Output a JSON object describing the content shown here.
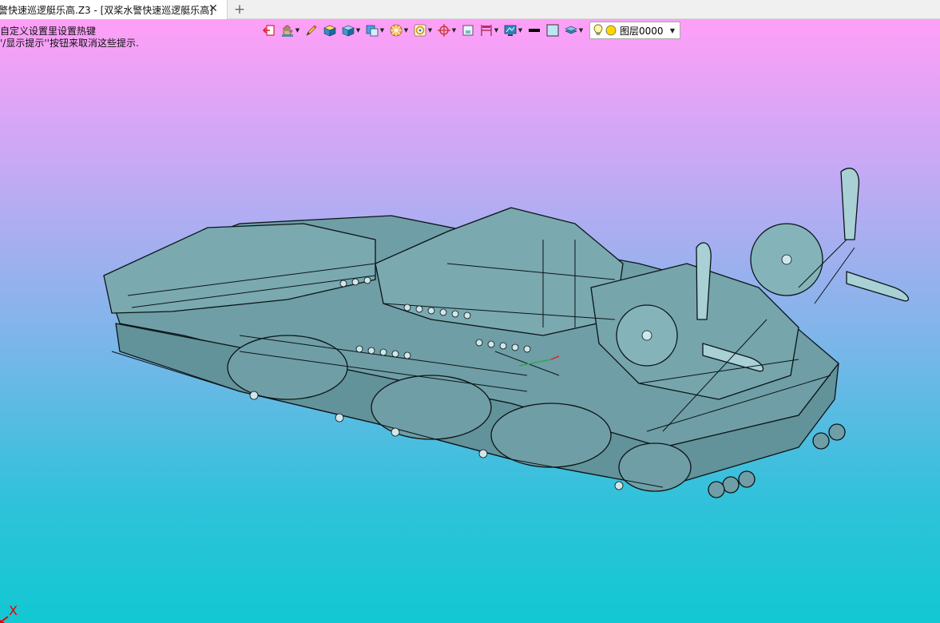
{
  "tab": {
    "title": "警快速巡逻艇乐高.Z3 - [双桨水警快速巡逻艇乐高]",
    "close_glyph": "✕",
    "add_glyph": "+"
  },
  "viewport": {
    "hint_line1": "自定义设置里设置热键",
    "hint_line2": "'/显示提示''按钮来取消这些提示."
  },
  "toolbar": {
    "items": [
      {
        "icon": "exit-icon",
        "dropdown": false
      },
      {
        "icon": "hand-pan-icon",
        "dropdown": true
      },
      {
        "icon": "pencil-icon",
        "dropdown": false
      },
      {
        "icon": "box-shaded-icon",
        "dropdown": false
      },
      {
        "icon": "cube-icon",
        "dropdown": true
      },
      {
        "icon": "view-cube-icon",
        "dropdown": true
      },
      {
        "icon": "render-mode-icon",
        "dropdown": true
      },
      {
        "icon": "snap-icon",
        "dropdown": true
      },
      {
        "icon": "crosshair-icon",
        "dropdown": true
      },
      {
        "icon": "frame-icon",
        "dropdown": false
      },
      {
        "icon": "dimension-icon",
        "dropdown": true
      },
      {
        "icon": "display-icon",
        "dropdown": true
      },
      {
        "icon": "line-color-icon",
        "dropdown": false
      },
      {
        "icon": "fill-color-icon",
        "dropdown": false
      },
      {
        "icon": "layers-stack-icon",
        "dropdown": true
      }
    ],
    "layer": {
      "name": "图层0000",
      "bulb_icon": "lightbulb-icon",
      "state_icon": "layer-on-icon"
    }
  },
  "axis": {
    "x_label": "X",
    "x_color": "#e00000"
  },
  "colors": {
    "background_top": "#ff9ff7",
    "background_bottom": "#12c8d2",
    "model_fill": "#6f9ea6",
    "model_line": "#0b1416"
  }
}
